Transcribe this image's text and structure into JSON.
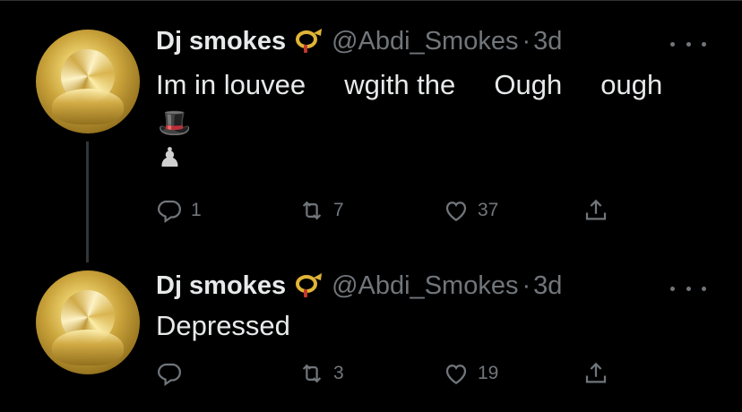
{
  "tweets": [
    {
      "name": "Dj smokes",
      "handle": "@Abdi_Smokes",
      "sep": "·",
      "time": "3d",
      "text": "Im in louvee     wgith the     Ough     ough",
      "emojis": [
        "🎩",
        "♟"
      ],
      "reply_count": "1",
      "retweet_count": "7",
      "like_count": "37",
      "icons": {
        "badge": "post-horn-icon",
        "reply": "reply-icon",
        "retweet": "retweet-icon",
        "like": "heart-icon",
        "share": "share-icon",
        "more": "more-icon"
      }
    },
    {
      "name": "Dj smokes",
      "handle": "@Abdi_Smokes",
      "sep": "·",
      "time": "3d",
      "text": "Depressed",
      "reply_count": "",
      "retweet_count": "3",
      "like_count": "19"
    }
  ],
  "colors": {
    "background": "#000000",
    "text": "#e7e9ea",
    "muted": "#71767b",
    "badge_gold": "#e0b436",
    "badge_red": "#c0392b"
  }
}
